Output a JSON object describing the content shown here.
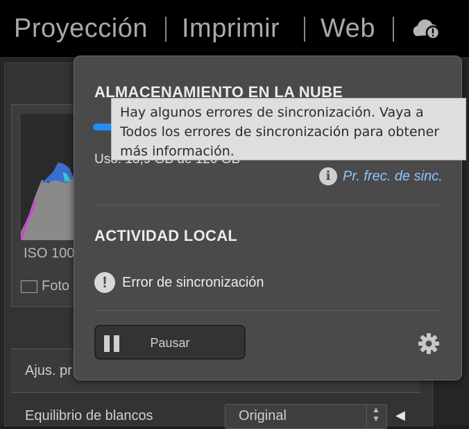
{
  "modules": {
    "proyeccion": "Proyección",
    "imprimir": "Imprimir",
    "web": "Web",
    "cloud_icon": "cloud-alert-icon"
  },
  "background": {
    "iso": "ISO 100",
    "foto": "Foto",
    "ajus": "Ajus. pr",
    "wb_label": "Equilibrio de blancos",
    "wb_value": "Original"
  },
  "popup": {
    "cloud_title": "ALMACENAMIENTO EN LA NUBE",
    "progress": 0.11,
    "progress_color": "#1f8ff5",
    "usage": "Uso: 13,9 GB de 120 GB",
    "faq_icon": "info-icon",
    "faq_link": "Pr. frec. de sinc.",
    "local_title": "ACTIVIDAD LOCAL",
    "error_icon": "alert-icon",
    "error_text": "Error de sincronización",
    "pause_label": "Pausar",
    "settings_icon": "gear-icon"
  },
  "tooltip": {
    "text": "Hay algunos errores de sincronización. Vaya a Todos los errores de sincronización para obtener más información."
  }
}
